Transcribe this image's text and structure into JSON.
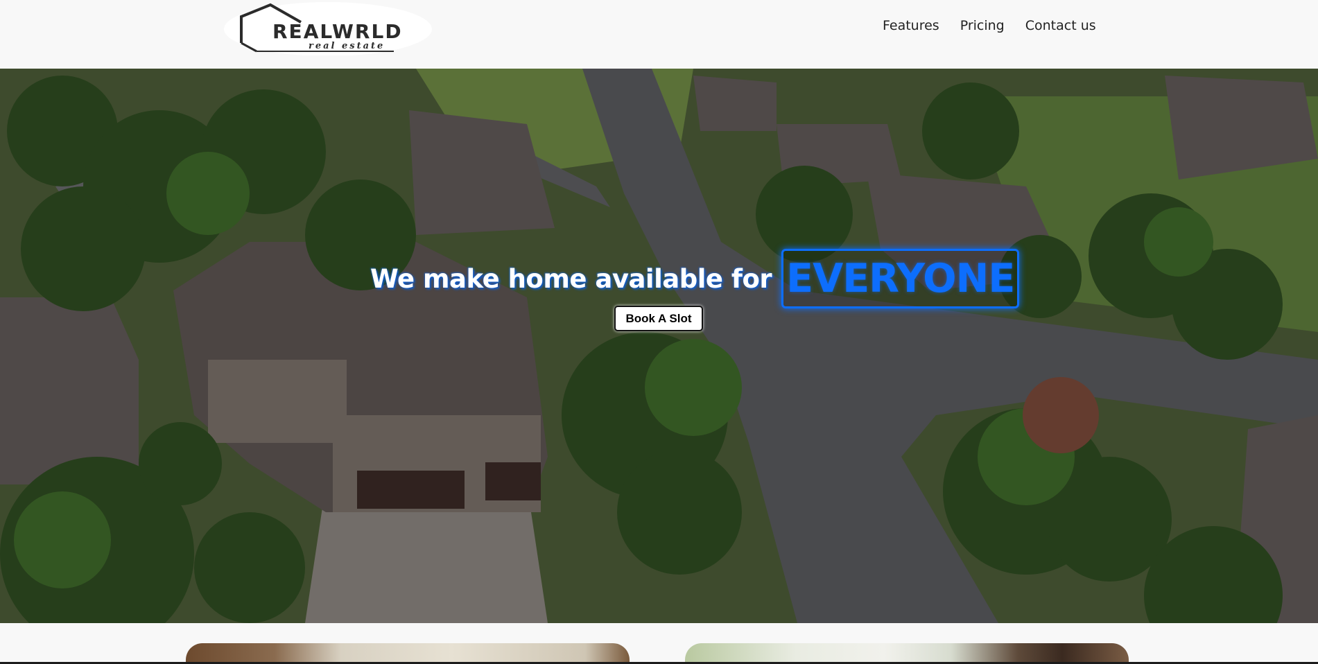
{
  "logo": {
    "word": "REALWRLD",
    "subtitle": "real estate"
  },
  "nav": {
    "items": [
      {
        "label": "Features"
      },
      {
        "label": "Pricing"
      },
      {
        "label": "Contact us"
      }
    ]
  },
  "hero": {
    "headline": "We make home available for",
    "highlight": "EVERYONE",
    "cta_label": "Book A Slot"
  },
  "colors": {
    "accent": "#0d6efd",
    "header_bg": "#f8f8f8",
    "text": "#222222"
  },
  "icons": {
    "logo_mark": "house-outline-icon"
  }
}
